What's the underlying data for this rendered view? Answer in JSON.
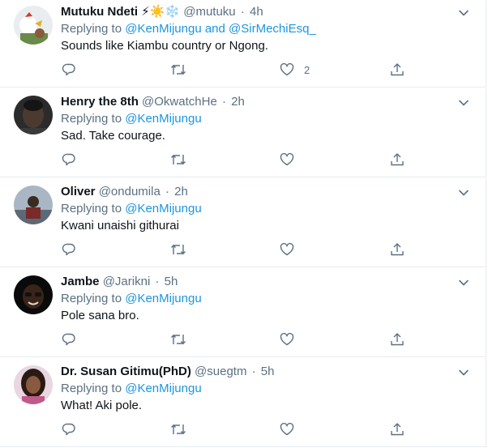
{
  "tweets": [
    {
      "name": "Mutuku Ndeti",
      "emoji": "⚡☀️❄️",
      "handle": "@mutuku",
      "sep": "·",
      "time": "4h",
      "replying_prefix": "Replying to",
      "replying_mentions": "@KenMijungu and @SirMechiEsq_",
      "text": "Sounds like Kiambu country or Ngong.",
      "like_count": "2"
    },
    {
      "name": "Henry the 8th",
      "emoji": "",
      "handle": "@OkwatchHe",
      "sep": "·",
      "time": "2h",
      "replying_prefix": "Replying to",
      "replying_mentions": "@KenMijungu",
      "text": "Sad. Take courage.",
      "like_count": ""
    },
    {
      "name": "Oliver",
      "emoji": "",
      "handle": "@ondumila",
      "sep": "·",
      "time": "2h",
      "replying_prefix": "Replying to",
      "replying_mentions": "@KenMijungu",
      "text": "Kwani unaishi githurai",
      "like_count": ""
    },
    {
      "name": "Jambe",
      "emoji": "",
      "handle": "@Jarikni",
      "sep": "·",
      "time": "5h",
      "replying_prefix": "Replying to",
      "replying_mentions": "@KenMijungu",
      "text": "Pole sana bro.",
      "like_count": ""
    },
    {
      "name": "Dr. Susan Gitimu(PhD)",
      "emoji": "",
      "handle": "@suegtm",
      "sep": "·",
      "time": "5h",
      "replying_prefix": "Replying to",
      "replying_mentions": "@KenMijungu",
      "text": "What! Aki pole.",
      "like_count": ""
    }
  ],
  "icons": [
    "avatar",
    "chevron-down-icon",
    "reply-icon",
    "retweet-icon",
    "like-icon",
    "share-icon"
  ],
  "colors": {
    "accent": "#1b95e0",
    "muted": "#5b7083",
    "text": "#0f1419",
    "border": "#e6ecf0"
  }
}
